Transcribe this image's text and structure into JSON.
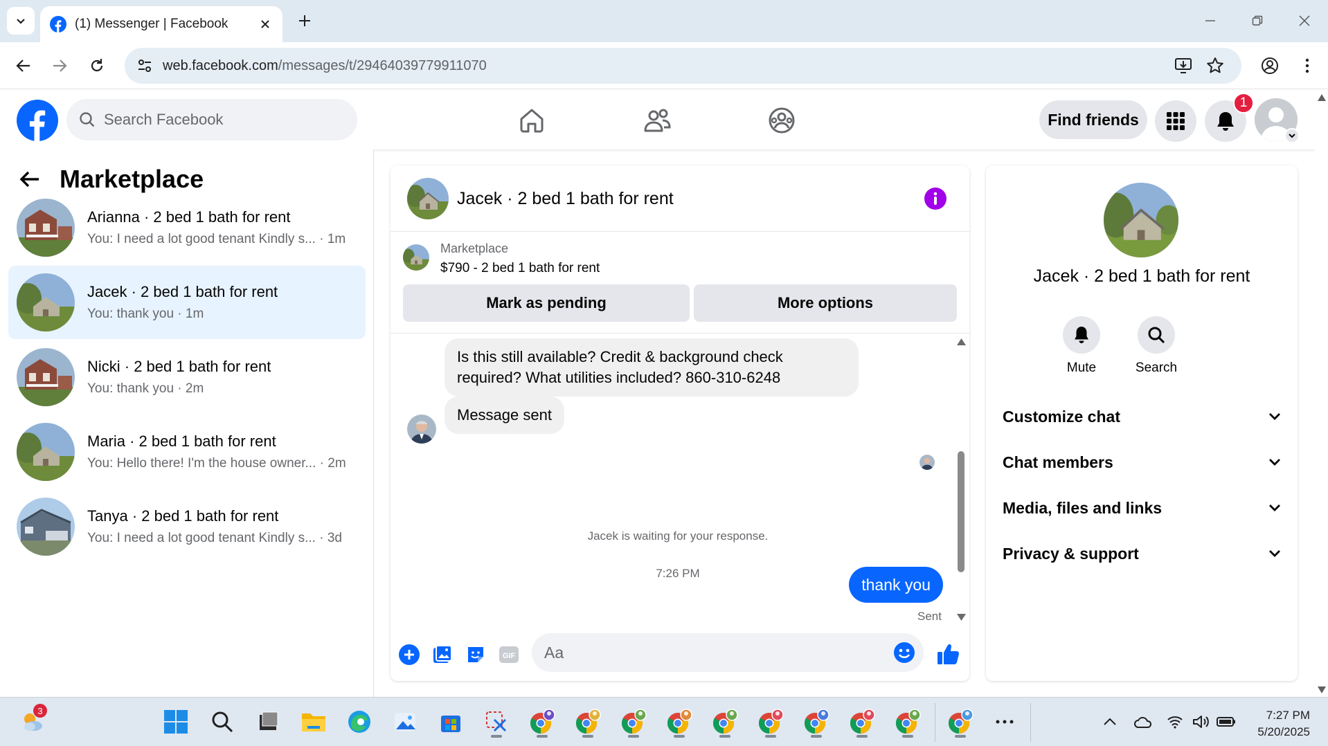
{
  "browser": {
    "tab_title": "(1) Messenger | Facebook",
    "url_host": "web.facebook.com",
    "url_path": "/messages/t/29464039779911070"
  },
  "fb_header": {
    "search_placeholder": "Search Facebook",
    "find_friends": "Find friends",
    "notification_count": "1",
    "brand_color": "#0866ff"
  },
  "left_panel": {
    "title": "Marketplace",
    "conversations": [
      {
        "name": "Arianna · 2 bed 1 bath for rent",
        "preview": "You: I need a lot good tenant Kindly s...",
        "time": "1m",
        "active": false
      },
      {
        "name": "Jacek · 2 bed 1 bath for rent",
        "preview": "You: thank you",
        "time": "1m",
        "active": true
      },
      {
        "name": "Nicki · 2 bed 1 bath for rent",
        "preview": "You: thank you",
        "time": "2m",
        "active": false
      },
      {
        "name": "Maria · 2 bed 1 bath for rent",
        "preview": "You: Hello there! I'm the house owner...",
        "time": "2m",
        "active": false
      },
      {
        "name": "Tanya · 2 bed 1 bath for rent",
        "preview": "You: I need a lot good tenant Kindly s...",
        "time": "3d",
        "active": false
      }
    ]
  },
  "chat": {
    "title": "Jacek · 2 bed 1 bath for rent",
    "listing_category": "Marketplace",
    "listing_price": "$790 - 2 bed 1 bath for rent",
    "mark_pending": "Mark as pending",
    "more_options": "More options",
    "messages": {
      "incoming_1": "Is this still available? Credit & background check required? What utilities included? 860-310-6248",
      "incoming_2": "Message sent",
      "waiting": "Jacek is waiting for your response.",
      "timestamp": "7:26 PM",
      "outgoing": "thank you",
      "status": "Sent"
    },
    "composer_placeholder": "Aa"
  },
  "right_panel": {
    "name": "Jacek · 2 bed 1 bath for rent",
    "mute": "Mute",
    "search": "Search",
    "sections": [
      "Customize chat",
      "Chat members",
      "Media, files and links",
      "Privacy & support"
    ]
  },
  "taskbar": {
    "weather_badge": "3",
    "time": "7:27 PM",
    "date": "5/20/2025"
  }
}
